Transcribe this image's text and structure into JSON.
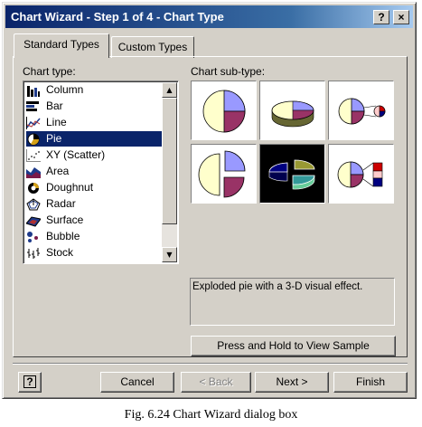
{
  "window": {
    "title": "Chart Wizard - Step 1 of 4 - Chart Type",
    "help_btn": "?",
    "close_btn": "×"
  },
  "tabs": [
    {
      "label": "Standard Types",
      "active": true
    },
    {
      "label": "Custom Types",
      "active": false
    }
  ],
  "chart_type": {
    "label": "Chart type:",
    "items": [
      {
        "label": "Column",
        "icon": "column-chart-icon"
      },
      {
        "label": "Bar",
        "icon": "bar-chart-icon"
      },
      {
        "label": "Line",
        "icon": "line-chart-icon"
      },
      {
        "label": "Pie",
        "icon": "pie-chart-icon",
        "selected": true
      },
      {
        "label": "XY (Scatter)",
        "icon": "scatter-chart-icon"
      },
      {
        "label": "Area",
        "icon": "area-chart-icon"
      },
      {
        "label": "Doughnut",
        "icon": "doughnut-chart-icon"
      },
      {
        "label": "Radar",
        "icon": "radar-chart-icon"
      },
      {
        "label": "Surface",
        "icon": "surface-chart-icon"
      },
      {
        "label": "Bubble",
        "icon": "bubble-chart-icon"
      },
      {
        "label": "Stock",
        "icon": "stock-chart-icon"
      }
    ]
  },
  "chart_subtype": {
    "label": "Chart sub-type:",
    "selected_index": 4,
    "items": [
      "pie",
      "3d-pie",
      "pie-of-pie",
      "exploded-pie",
      "exploded-3d-pie",
      "bar-of-pie"
    ]
  },
  "description": "Exploded pie with a 3-D visual effect.",
  "buttons": {
    "sample": "Press and Hold to View Sample",
    "help": "?",
    "cancel": "Cancel",
    "back": "< Back",
    "next": "Next >",
    "finish": "Finish"
  },
  "caption": "Fig. 6.24 Chart Wizard dialog box",
  "colors": {
    "titlebar_start": "#0a246a",
    "face": "#d4d0c8",
    "selection": "#0a246a"
  }
}
